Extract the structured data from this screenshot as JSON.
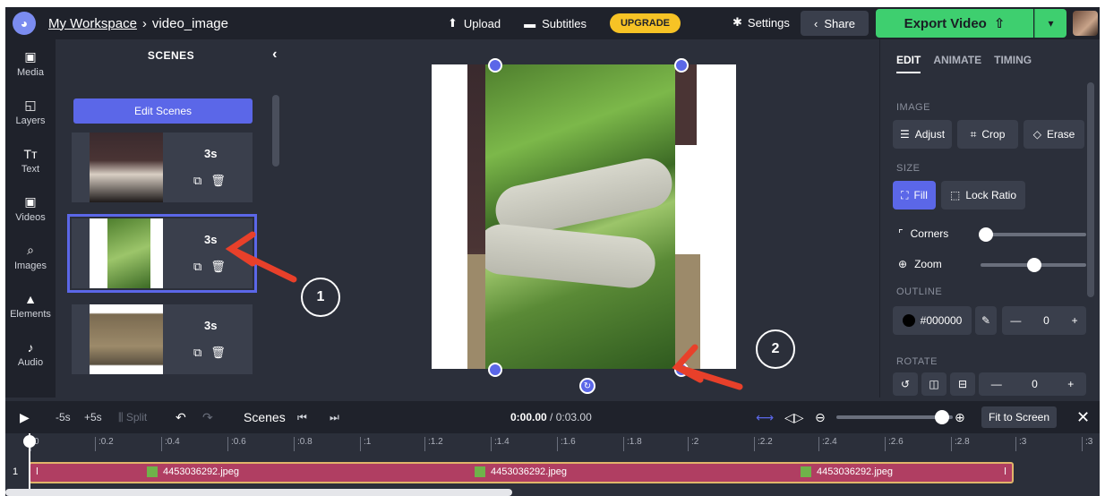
{
  "topbar": {
    "workspace": "My Workspace",
    "project": "video_image",
    "upload": "Upload",
    "subtitles": "Subtitles",
    "upgrade": "UPGRADE",
    "settings": "Settings",
    "share": "Share",
    "export": "Export Video"
  },
  "rail": [
    {
      "label": "Media",
      "icon": "▣"
    },
    {
      "label": "Layers",
      "icon": "◱"
    },
    {
      "label": "Text",
      "icon": "Tт"
    },
    {
      "label": "Videos",
      "icon": "▣"
    },
    {
      "label": "Images",
      "icon": "⌕"
    },
    {
      "label": "Elements",
      "icon": "▲"
    },
    {
      "label": "Audio",
      "icon": "♪"
    }
  ],
  "scenes": {
    "title": "SCENES",
    "edit_label": "Edit Scenes",
    "items": [
      {
        "duration": "3s"
      },
      {
        "duration": "3s"
      },
      {
        "duration": "3s"
      }
    ]
  },
  "callouts": {
    "one": "1",
    "two": "2"
  },
  "props": {
    "tabs": [
      "EDIT",
      "ANIMATE",
      "TIMING"
    ],
    "image_section": "IMAGE",
    "adjust": "Adjust",
    "crop": "Crop",
    "erase": "Erase",
    "size_section": "SIZE",
    "fill": "Fill",
    "lock_ratio": "Lock Ratio",
    "corners": "Corners",
    "zoom": "Zoom",
    "outline_section": "OUTLINE",
    "outline_color": "#000000",
    "outline_value": "0",
    "rotate_section": "ROTATE",
    "rotate_value": "0"
  },
  "timeline": {
    "minus5": "-5s",
    "plus5": "+5s",
    "split": "Split",
    "scenes": "Scenes",
    "current_time": "0:00.00",
    "total_time": "/ 0:03.00",
    "fit": "Fit to Screen",
    "ticks": [
      "0",
      ":0.2",
      ":0.4",
      ":0.6",
      ":0.8",
      ":1",
      ":1.2",
      ":1.4",
      ":1.6",
      ":1.8",
      ":2",
      ":2.2",
      ":2.4",
      ":2.6",
      ":2.8",
      ":3",
      ":3"
    ],
    "track_number": "1",
    "clip_files": [
      "4453036292.jpeg",
      "4453036292.jpeg",
      "4453036292.jpeg"
    ]
  },
  "colors": {
    "accent": "#5b67e8",
    "export": "#3ecf6f",
    "upgrade": "#f7c325",
    "clip": "#b03e62"
  }
}
